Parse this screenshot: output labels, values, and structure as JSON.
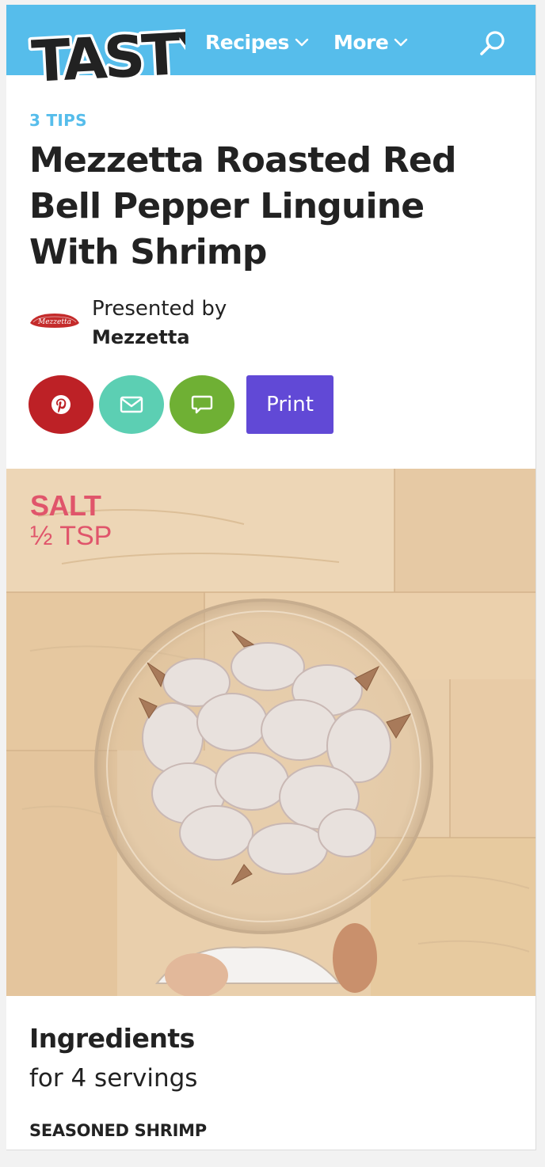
{
  "header": {
    "logo_text": "TASTY",
    "nav": [
      {
        "label": "Recipes"
      },
      {
        "label": "More"
      }
    ],
    "colors": {
      "bar": "#56bdeb",
      "logo": "#222222"
    }
  },
  "article": {
    "tips_label": "3 TIPS",
    "title": "Mezzetta Roasted Red Bell Pepper Linguine With Shrimp",
    "presented_by_label": "Presented by",
    "sponsor_name": "Mezzetta",
    "sponsor_logo_text": "Mezzetta"
  },
  "share": {
    "pinterest_icon": "pinterest-icon",
    "email_icon": "email-icon",
    "comment_icon": "comment-icon",
    "print_label": "Print",
    "colors": {
      "pinterest": "#bd2126",
      "email": "#5ccfb3",
      "comment": "#6fb034",
      "print": "#6149d6"
    }
  },
  "video": {
    "ingredient_name": "SALT",
    "ingredient_qty": "½ TSP"
  },
  "ingredients": {
    "heading": "Ingredients",
    "servings": "for 4 servings",
    "section": "SEASONED SHRIMP"
  }
}
